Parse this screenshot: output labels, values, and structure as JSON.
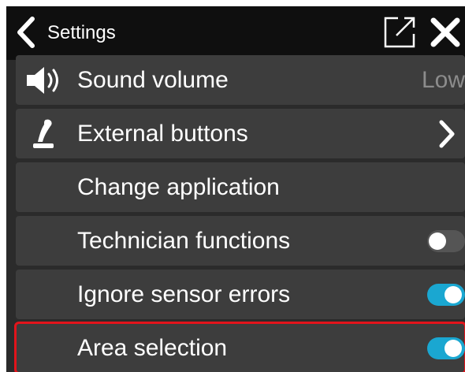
{
  "header": {
    "title": "Settings",
    "back_icon": "chevron-left-icon",
    "popout_icon": "external-window-icon",
    "close_icon": "close-icon"
  },
  "rows": [
    {
      "label": "Sound volume",
      "icon": "speaker-icon",
      "value": "Low"
    },
    {
      "label": "External buttons",
      "icon": "joystick-icon",
      "trailing": "chevron-right-icon"
    },
    {
      "label": "Change application"
    },
    {
      "label": "Technician functions",
      "toggle": "off"
    },
    {
      "label": "Ignore sensor errors",
      "toggle": "on"
    },
    {
      "label": "Area selection",
      "toggle": "on",
      "highlighted": true
    }
  ],
  "colors": {
    "header_bg": "#0f0f0f",
    "panel_bg": "#2b2b2b",
    "row_bg": "#3d3d3d",
    "toggle_on": "#1aa7d1",
    "toggle_off": "#555555",
    "highlight": "#e3141b",
    "value_text": "#8c8c8c"
  }
}
